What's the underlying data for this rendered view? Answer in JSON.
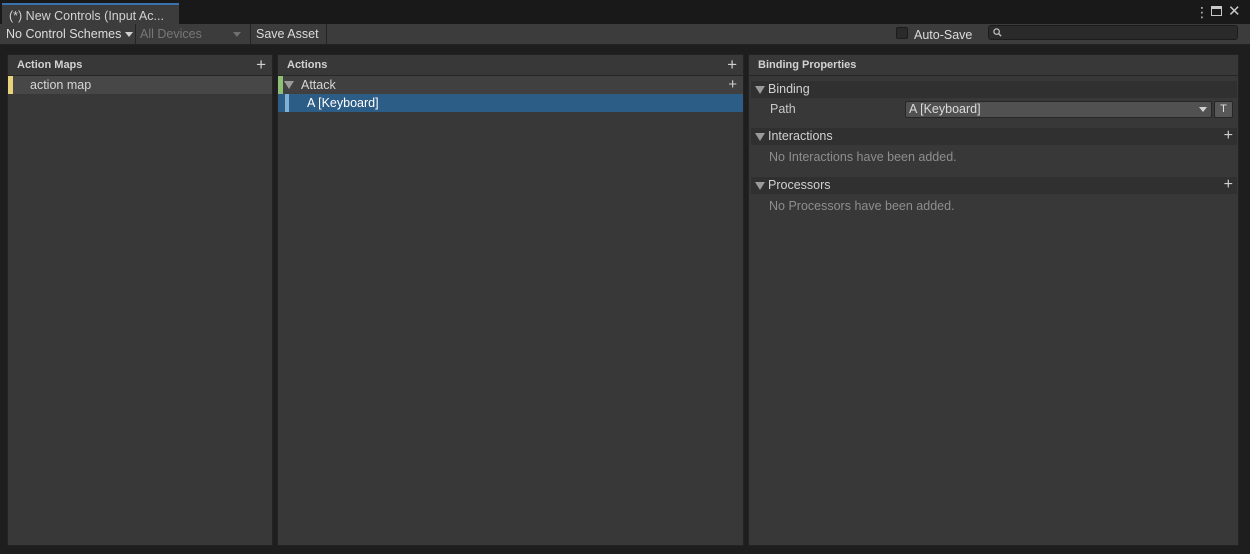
{
  "window": {
    "tab_title": "(*) New Controls (Input Ac...",
    "menu_icon": "more-vertical-icon",
    "maximize_icon": "maximize-icon",
    "close_icon": "close-icon"
  },
  "toolbar": {
    "control_schemes": "No Control Schemes",
    "devices": "All Devices",
    "save_asset": "Save Asset",
    "auto_save_label": "Auto-Save",
    "auto_save_checked": false,
    "search_value": "",
    "search_icon": "search-icon"
  },
  "action_maps": {
    "header": "Action Maps",
    "add_icon": "plus-icon",
    "items": [
      {
        "label": "action map",
        "color": "#e8d27a"
      }
    ]
  },
  "actions": {
    "header": "Actions",
    "add_icon": "plus-icon",
    "items": [
      {
        "label": "Attack",
        "color": "#8fbf74",
        "expanded": true,
        "bindings": [
          {
            "label": "A [Keyboard]",
            "color": "#7fb2d3",
            "selected": true
          }
        ]
      }
    ]
  },
  "properties": {
    "header": "Binding Properties",
    "binding": {
      "title": "Binding",
      "path_label": "Path",
      "path_value": "A [Keyboard]",
      "t_button": "T"
    },
    "interactions": {
      "title": "Interactions",
      "empty": "No Interactions have been added."
    },
    "processors": {
      "title": "Processors",
      "empty": "No Processors have been added."
    }
  },
  "colors": {
    "selection": "#2c5d87",
    "panel_bg": "#383838",
    "accent_tab": "#3a72b0"
  }
}
